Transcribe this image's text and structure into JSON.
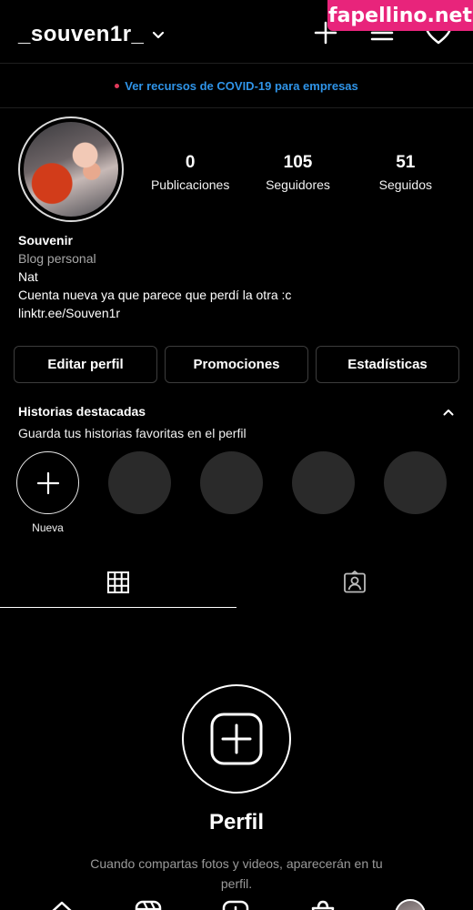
{
  "header": {
    "username": "_souven1r_",
    "icons": [
      "chevron-down-icon",
      "new-post-icon",
      "menu-icon",
      "heart-icon"
    ]
  },
  "watermark": {
    "text": "fapellino.net"
  },
  "covid_banner": {
    "text": "Ver recursos de COVID-19 para empresas"
  },
  "profile": {
    "stats": [
      {
        "value": "0",
        "label": "Publicaciones"
      },
      {
        "value": "105",
        "label": "Seguidores"
      },
      {
        "value": "51",
        "label": "Seguidos"
      }
    ],
    "name": "Souvenir",
    "category": "Blog personal",
    "bio_lines": [
      "Nat",
      "Cuenta nueva ya que parece que perdí la otra :c"
    ],
    "link": "linktr.ee/Souven1r"
  },
  "actions": {
    "edit": "Editar perfil",
    "promotions": "Promociones",
    "statistics": "Estadísticas"
  },
  "highlights": {
    "title": "Historias destacadas",
    "subtitle": "Guarda tus historias favoritas en el perfil",
    "new_label": "Nueva"
  },
  "empty_state": {
    "title": "Perfil",
    "text": "Cuando compartas fotos y videos, aparecerán en tu perfil."
  },
  "colors": {
    "link": "#2f94e8",
    "dot": "#e0395a",
    "watermark": "#e8247b"
  }
}
